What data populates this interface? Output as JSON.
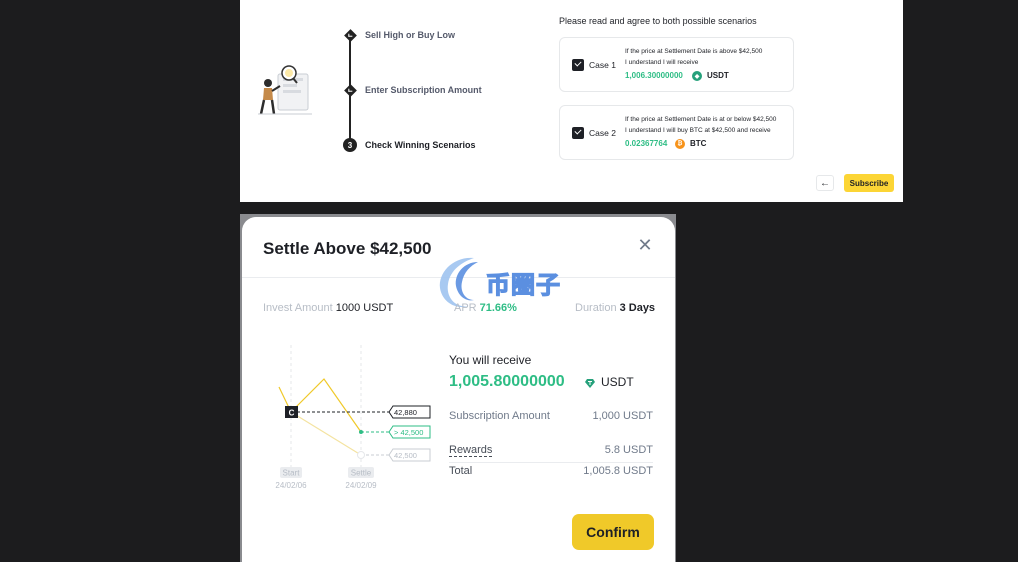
{
  "subscription": {
    "steps": [
      {
        "label": "Sell High or Buy Low",
        "state": "done"
      },
      {
        "label": "Enter Subscription Amount",
        "state": "done"
      },
      {
        "label": "Check Winning Scenarios",
        "state": "current",
        "number": "3"
      }
    ],
    "agree_title": "Please read and agree to both possible scenarios",
    "cases": [
      {
        "label": "Case 1",
        "checked": true,
        "line1": "If the price at Settlement Date is above $42,500",
        "line2": "I understand I will receive",
        "amount": "1,006.30000000",
        "unit": "USDT",
        "coin_icon": "usdt-icon"
      },
      {
        "label": "Case 2",
        "checked": true,
        "line1": "If the price at Settlement Date is at or below $42,500",
        "line2": "I understand I will buy  BTC  at  $42,500  and receive",
        "amount": "0.02367764",
        "unit": "BTC",
        "coin_icon": "btc-icon"
      }
    ],
    "back_icon": "←",
    "subscribe_label": "Subscribe"
  },
  "modal": {
    "title": "Settle Above $42,500",
    "close_icon": "✕",
    "invest_label": "Invest Amount",
    "invest_value": "1000 USDT",
    "apr_label": "APR",
    "apr_value": "71.66%",
    "duration_label": "Duration",
    "duration_value": "3 Days",
    "watermark_text": "币圈子",
    "chart": {
      "current_marker": "C",
      "tags": [
        "42,880",
        "> 42,500",
        "42,500"
      ],
      "start_label": "Start",
      "start_date": "24/02/06",
      "settle_label": "Settle",
      "settle_date": "24/02/09"
    },
    "receive_label": "You will receive",
    "receive_amount": "1,005.80000000",
    "receive_unit": "USDT",
    "rows": [
      {
        "label": "Subscription Amount",
        "value": "1,000 USDT"
      },
      {
        "label": "Rewards",
        "value": "5.8 USDT"
      },
      {
        "label": "Total",
        "value": "1,005.8 USDT"
      }
    ],
    "confirm_label": "Confirm"
  },
  "colors": {
    "accent_yellow": "#fcd535",
    "positive_green": "#2ebd85",
    "usdt": "#26a17b",
    "btc": "#f7931a"
  }
}
